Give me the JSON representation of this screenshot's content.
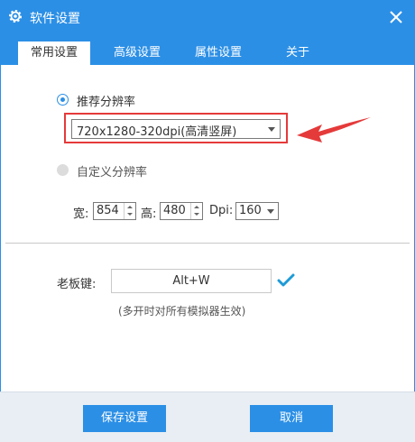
{
  "window": {
    "title": "软件设置",
    "close_icon": "close-icon"
  },
  "tabs": [
    {
      "label": "常用设置",
      "active": true
    },
    {
      "label": "高级设置",
      "active": false
    },
    {
      "label": "属性设置",
      "active": false
    },
    {
      "label": "关于",
      "active": false
    }
  ],
  "resolution": {
    "recommended_label": "推荐分辨率",
    "recommended_selected": true,
    "recommended_value": "720x1280-320dpi(高清竖屏)",
    "custom_label": "自定义分辨率",
    "custom_selected": false,
    "width_label": "宽:",
    "width_value": "854",
    "height_label": "高:",
    "height_value": "480",
    "dpi_label": "Dpi:",
    "dpi_value": "160"
  },
  "boss_key": {
    "label": "老板键:",
    "value": "Alt+W",
    "note": "(多开时对所有模拟器生效)"
  },
  "footer": {
    "save_label": "保存设置",
    "cancel_label": "取消"
  },
  "colors": {
    "accent": "#2b8fe6",
    "highlight": "#e53a3a",
    "check": "#1e9bd7"
  }
}
